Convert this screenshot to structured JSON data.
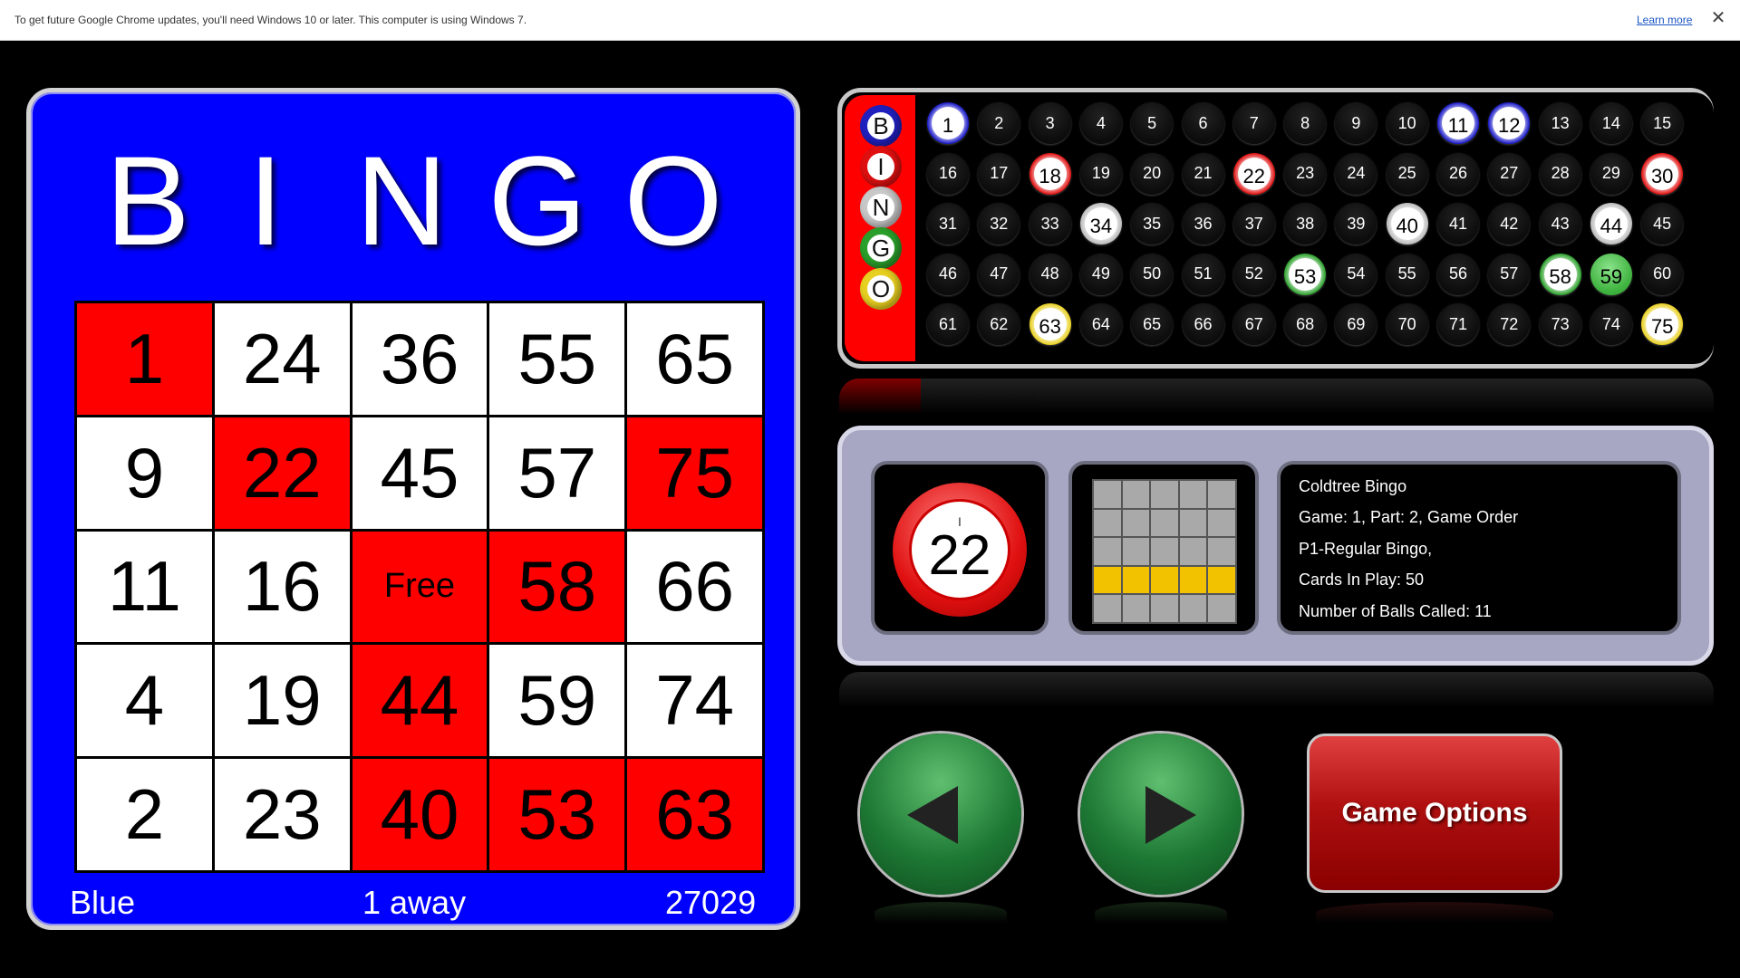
{
  "banner": {
    "message": "To get future Google Chrome updates, you'll need Windows 10 or later. This computer is using Windows 7.",
    "learn_more": "Learn more",
    "close": "✕"
  },
  "card": {
    "header": [
      "B",
      "I",
      "N",
      "G",
      "O"
    ],
    "rows": [
      [
        {
          "v": "1",
          "m": true
        },
        {
          "v": "24",
          "m": false
        },
        {
          "v": "36",
          "m": false
        },
        {
          "v": "55",
          "m": false
        },
        {
          "v": "65",
          "m": false
        }
      ],
      [
        {
          "v": "9",
          "m": false
        },
        {
          "v": "22",
          "m": true
        },
        {
          "v": "45",
          "m": false
        },
        {
          "v": "57",
          "m": false
        },
        {
          "v": "75",
          "m": true
        }
      ],
      [
        {
          "v": "11",
          "m": false
        },
        {
          "v": "16",
          "m": false
        },
        {
          "v": "Free",
          "m": true,
          "free": true
        },
        {
          "v": "58",
          "m": true
        },
        {
          "v": "66",
          "m": false
        }
      ],
      [
        {
          "v": "4",
          "m": false
        },
        {
          "v": "19",
          "m": false
        },
        {
          "v": "44",
          "m": true
        },
        {
          "v": "59",
          "m": false
        },
        {
          "v": "74",
          "m": false
        }
      ],
      [
        {
          "v": "2",
          "m": false
        },
        {
          "v": "23",
          "m": false
        },
        {
          "v": "40",
          "m": true
        },
        {
          "v": "53",
          "m": true
        },
        {
          "v": "63",
          "m": true
        }
      ]
    ],
    "color_name": "Blue",
    "away": "1 away",
    "card_number": "27029",
    "marked_color": "#ff0000",
    "background_color": "#0000ff"
  },
  "board": {
    "letters": [
      "B",
      "I",
      "N",
      "G",
      "O"
    ],
    "letter_colors": [
      "#2020c0",
      "#e01010",
      "#c8c8c8",
      "#2aa02a",
      "#e8d020"
    ],
    "called": [
      1,
      11,
      12,
      18,
      22,
      30,
      34,
      40,
      44,
      53,
      58,
      59,
      63,
      75
    ]
  },
  "current_ball": {
    "letter": "I",
    "number": "22"
  },
  "pattern": {
    "rows": [
      [
        0,
        0,
        0,
        0,
        0
      ],
      [
        0,
        0,
        0,
        0,
        0
      ],
      [
        0,
        0,
        0,
        0,
        0
      ],
      [
        1,
        1,
        1,
        1,
        1
      ],
      [
        0,
        0,
        0,
        0,
        0
      ]
    ],
    "on_color": "#f2c200"
  },
  "info": {
    "venue": "Coldtree Bingo",
    "game_line": "Game: 1, Part: 2, Game Order",
    "game_type": "P1-Regular Bingo,",
    "cards_in_play": "Cards In Play: 50",
    "balls_called": "Number of Balls Called: 11"
  },
  "controls": {
    "prev_icon": "triangle-left-icon",
    "next_icon": "triangle-right-icon",
    "options_label": "Game Options"
  }
}
